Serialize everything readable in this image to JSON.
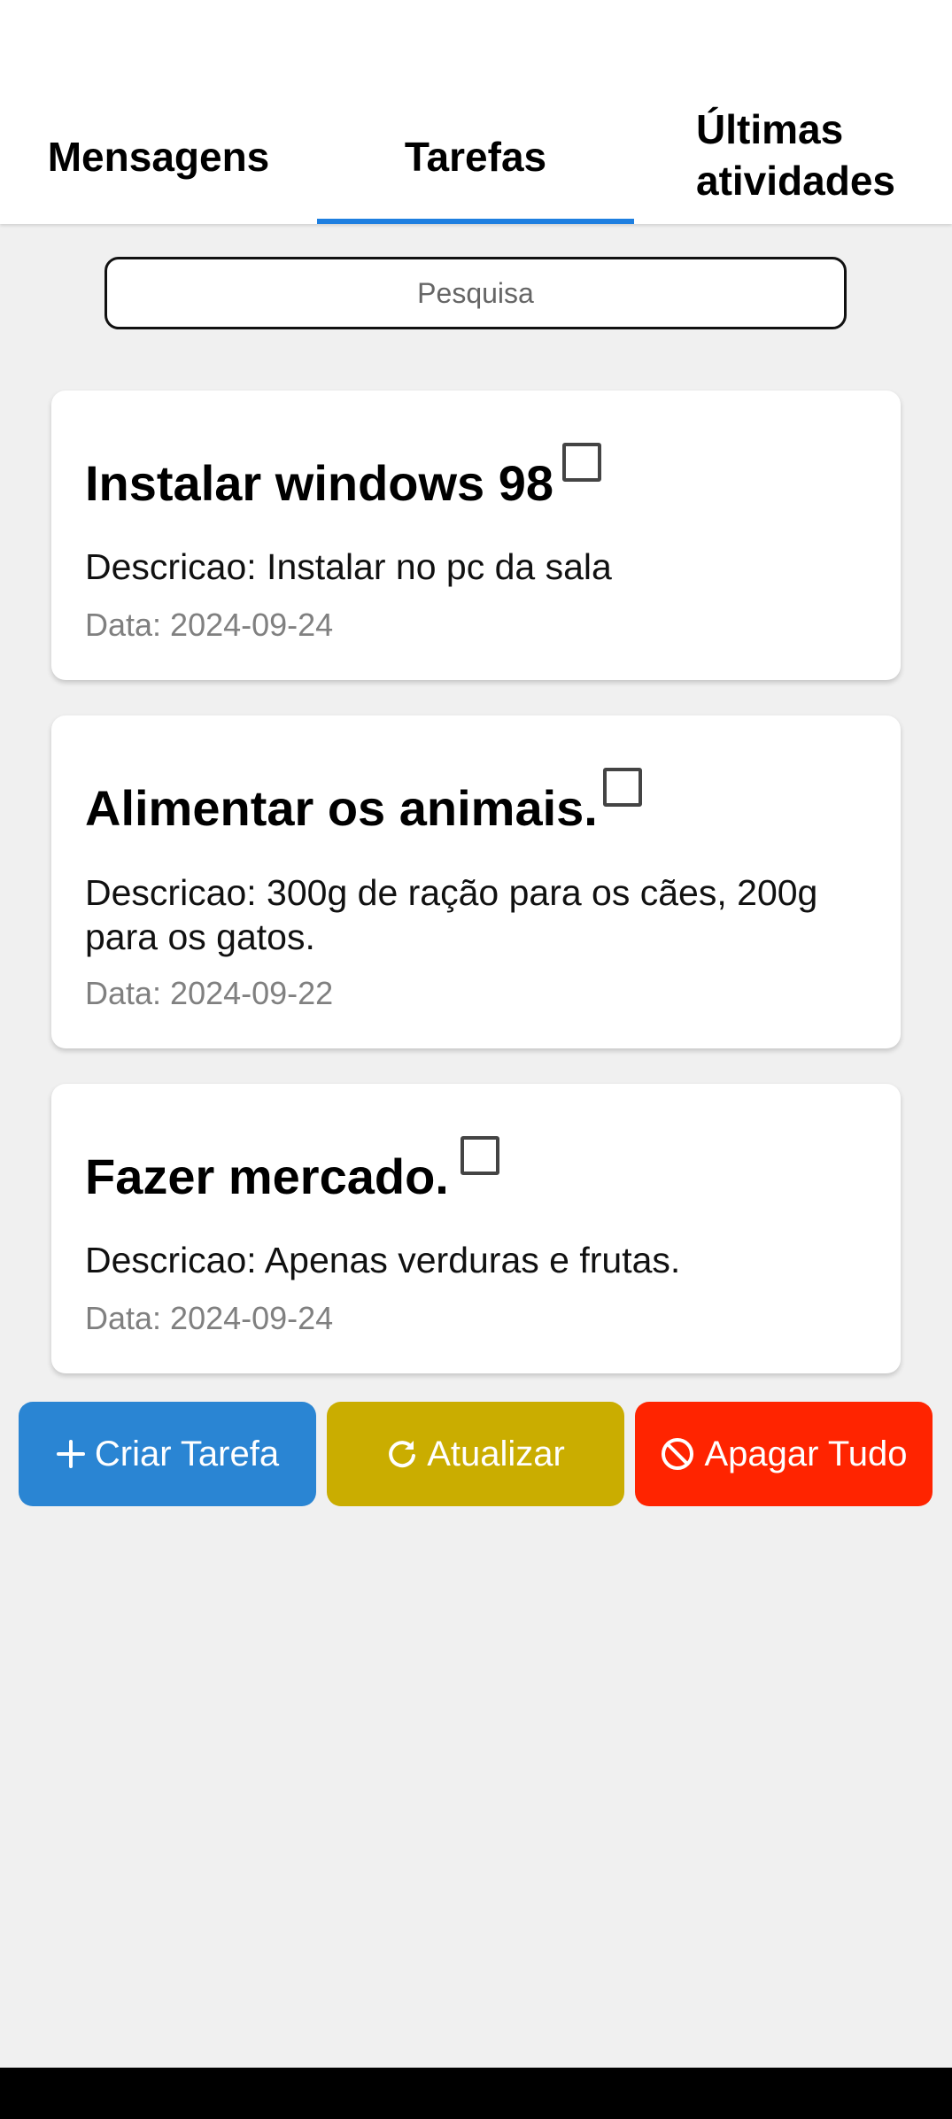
{
  "tabs": [
    {
      "label": "Mensagens"
    },
    {
      "label": "Tarefas",
      "active": true
    },
    {
      "label": "Últimas atividades"
    }
  ],
  "search": {
    "placeholder": "Pesquisa"
  },
  "tasks": [
    {
      "title": "Instalar windows 98",
      "description": "Descricao: Instalar no pc da sala",
      "date": "Data: 2024-09-24",
      "checked": false
    },
    {
      "title": "Alimentar os animais.",
      "description": "Descricao: 300g de ração para os cães, 200g para os gatos.",
      "date": "Data: 2024-09-22",
      "checked": false
    },
    {
      "title": "Fazer mercado.",
      "description": "Descricao: Apenas verduras e frutas.",
      "date": "Data: 2024-09-24",
      "checked": false
    }
  ],
  "buttons": {
    "create": {
      "label": "Criar Tarefa",
      "icon": "plus-icon",
      "color": "#2a85d3"
    },
    "refresh": {
      "label": "Atualizar",
      "icon": "refresh-icon",
      "color": "#caad00"
    },
    "clear": {
      "label": "Apagar Tudo",
      "icon": "ban-icon",
      "color": "#ff2400"
    }
  },
  "accent": "#1e7fe0"
}
